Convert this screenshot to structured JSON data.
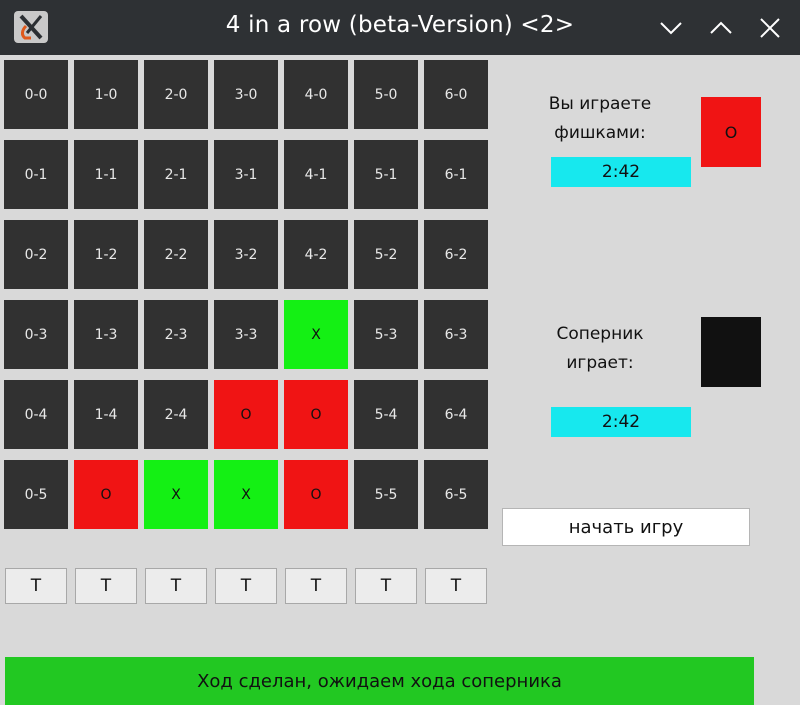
{
  "window": {
    "title": "4 in a row (beta-Version) <2>",
    "app_icon": "x-window-icon",
    "controls": [
      "minimize-chevron-down-icon",
      "maximize-chevron-up-icon",
      "close-icon"
    ]
  },
  "colors": {
    "empty": "#313131",
    "red": "#f01414",
    "green": "#14f014",
    "timer": "#17e8ee",
    "status": "#22c822",
    "opponent": "#111111"
  },
  "board": {
    "rows": [
      [
        {
          "label": "0-0",
          "state": "empty"
        },
        {
          "label": "1-0",
          "state": "empty"
        },
        {
          "label": "2-0",
          "state": "empty"
        },
        {
          "label": "3-0",
          "state": "empty"
        },
        {
          "label": "4-0",
          "state": "empty"
        },
        {
          "label": "5-0",
          "state": "empty"
        },
        {
          "label": "6-0",
          "state": "empty"
        }
      ],
      [
        {
          "label": "0-1",
          "state": "empty"
        },
        {
          "label": "1-1",
          "state": "empty"
        },
        {
          "label": "2-1",
          "state": "empty"
        },
        {
          "label": "3-1",
          "state": "empty"
        },
        {
          "label": "4-1",
          "state": "empty"
        },
        {
          "label": "5-1",
          "state": "empty"
        },
        {
          "label": "6-1",
          "state": "empty"
        }
      ],
      [
        {
          "label": "0-2",
          "state": "empty"
        },
        {
          "label": "1-2",
          "state": "empty"
        },
        {
          "label": "2-2",
          "state": "empty"
        },
        {
          "label": "3-2",
          "state": "empty"
        },
        {
          "label": "4-2",
          "state": "empty"
        },
        {
          "label": "5-2",
          "state": "empty"
        },
        {
          "label": "6-2",
          "state": "empty"
        }
      ],
      [
        {
          "label": "0-3",
          "state": "empty"
        },
        {
          "label": "1-3",
          "state": "empty"
        },
        {
          "label": "2-3",
          "state": "empty"
        },
        {
          "label": "3-3",
          "state": "empty"
        },
        {
          "label": "X",
          "state": "green"
        },
        {
          "label": "5-3",
          "state": "empty"
        },
        {
          "label": "6-3",
          "state": "empty"
        }
      ],
      [
        {
          "label": "0-4",
          "state": "empty"
        },
        {
          "label": "1-4",
          "state": "empty"
        },
        {
          "label": "2-4",
          "state": "empty"
        },
        {
          "label": "O",
          "state": "red"
        },
        {
          "label": "O",
          "state": "red"
        },
        {
          "label": "5-4",
          "state": "empty"
        },
        {
          "label": "6-4",
          "state": "empty"
        }
      ],
      [
        {
          "label": "0-5",
          "state": "empty"
        },
        {
          "label": "O",
          "state": "red"
        },
        {
          "label": "X",
          "state": "green"
        },
        {
          "label": "X",
          "state": "green"
        },
        {
          "label": "O",
          "state": "red"
        },
        {
          "label": "5-5",
          "state": "empty"
        },
        {
          "label": "6-5",
          "state": "empty"
        }
      ]
    ]
  },
  "drop_buttons": [
    "T",
    "T",
    "T",
    "T",
    "T",
    "T",
    "T"
  ],
  "player": {
    "label_line1": "Вы играете",
    "label_line2": "фишками:",
    "piece": "O",
    "piece_color": "#f01414",
    "timer": "2:42"
  },
  "opponent": {
    "label_line1": "Соперник",
    "label_line2": "играет:",
    "piece": "",
    "piece_color": "#111111",
    "timer": "2:42"
  },
  "start_button": "начать игру",
  "status": "Ход сделан, ожидаем хода соперника"
}
